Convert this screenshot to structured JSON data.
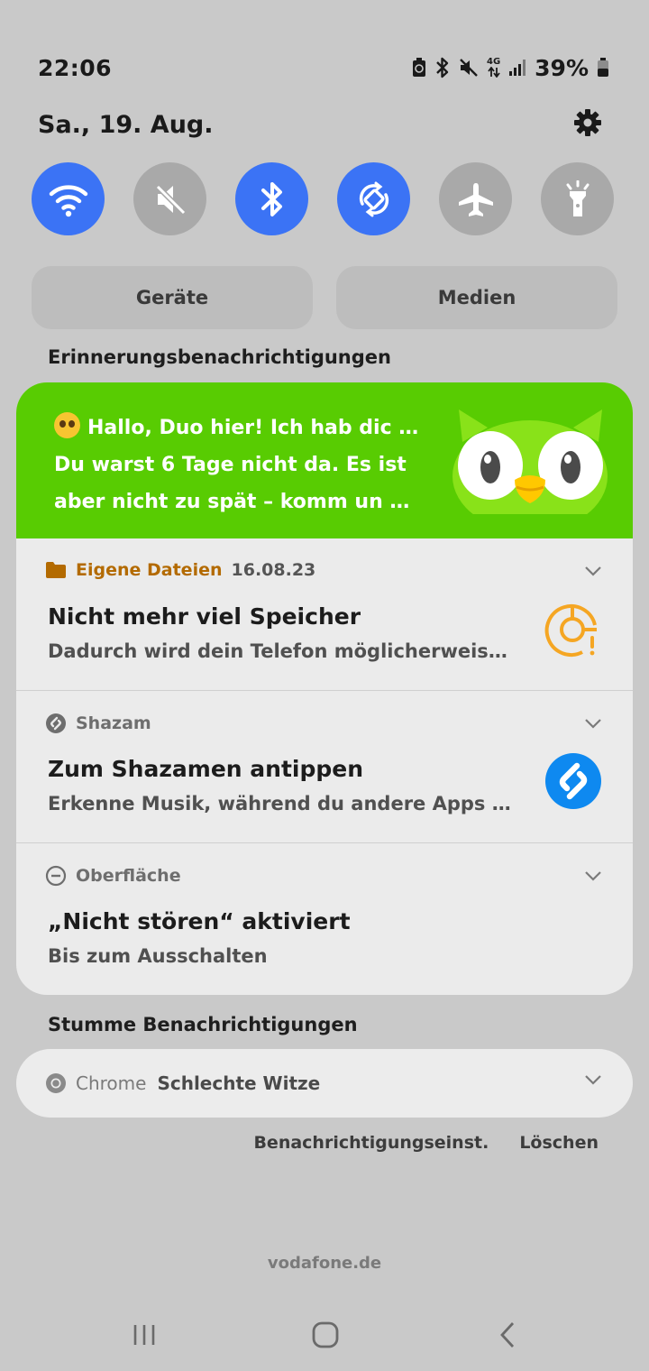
{
  "status_bar": {
    "time": "22:06",
    "network": "4G",
    "battery": "39%",
    "icons": [
      "battery-saver-icon",
      "bluetooth-icon",
      "mute-icon",
      "mobile-data-icon",
      "signal-icon",
      "battery-icon"
    ]
  },
  "header": {
    "date": "Sa., 19. Aug.",
    "settings_icon": "gear-icon"
  },
  "quick_toggles": [
    {
      "name": "wifi",
      "icon": "wifi-icon",
      "active": true
    },
    {
      "name": "sound",
      "icon": "mute-icon",
      "active": false
    },
    {
      "name": "bluetooth",
      "icon": "bluetooth-icon",
      "active": true
    },
    {
      "name": "auto-rotate",
      "icon": "rotate-icon",
      "active": true
    },
    {
      "name": "airplane",
      "icon": "airplane-icon",
      "active": false
    },
    {
      "name": "flashlight",
      "icon": "flashlight-icon",
      "active": false
    }
  ],
  "buttons": {
    "devices": "Geräte",
    "media": "Medien"
  },
  "sections": {
    "reminders": "Erinnerungsbenachrichtigungen",
    "silent": "Stumme Benachrichtigungen"
  },
  "duolingo": {
    "line1": "Hallo, Duo hier! Ich hab dic …",
    "line2": "Du warst 6 Tage nicht da. Es ist",
    "line3": "aber nicht zu spät – komm un …",
    "accent": "#58cc02"
  },
  "notifications": [
    {
      "app": "Eigene Dateien",
      "time": "16.08.23",
      "title": "Nicht mehr viel Speicher",
      "body": "Dadurch wird dein Telefon möglicherweise…",
      "icon": "storage-warning-icon",
      "color": "#f5a623"
    },
    {
      "app": "Shazam",
      "time": "",
      "title": "Zum Shazamen antippen",
      "body": "Erkenne Musik, während du andere Apps n…",
      "icon": "shazam-icon",
      "color": "#0e89f0"
    },
    {
      "app": "Oberfläche",
      "time": "",
      "title": "„Nicht stören“ aktiviert",
      "body": "Bis zum Ausschalten",
      "icon": "do-not-disturb-icon",
      "color": ""
    }
  ],
  "silent_notification": {
    "app": "Chrome",
    "text": "Schlechte Witze"
  },
  "actions": {
    "settings": "Benachrichtigungseinst.",
    "clear": "Löschen"
  },
  "carrier": "vodafone.de",
  "navbar": [
    "recents-icon",
    "home-icon",
    "back-icon"
  ]
}
